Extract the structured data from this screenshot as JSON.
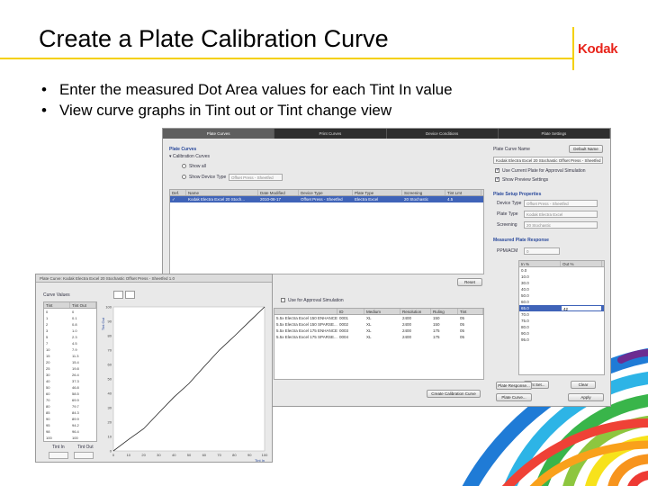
{
  "slide": {
    "title": "Create a Plate Calibration Curve",
    "logo": "Kodak",
    "bullets": [
      "Enter the measured Dot Area values for each Tint In value",
      "View curve graphs in Tint out or Tint change view"
    ],
    "bullet_glyph": "•",
    "colors": {
      "accent_rule": "#f4d000",
      "logo": "#e8241b"
    }
  },
  "screenshot": {
    "tabs": [
      "Plate Curves",
      "Print Curves",
      "Device Conditions",
      "Plate Settings"
    ],
    "left": {
      "header": "Plate Curves",
      "section": "Calibration Curves",
      "show_all": "Show all",
      "show_device_type": "Show Device Type",
      "device_type_value": "Offset Press - Sheetfed",
      "columns": [
        "Def.",
        "Name",
        "Date Modified",
        "Device Type",
        "Plate Type",
        "Screening",
        "Tint Lmt"
      ],
      "rows": [
        {
          "def": "✓",
          "name": "Kodak Electra Excel 20 Stoch...",
          "date": "2010-08-17",
          "device": "Offset Press - Sheetfed",
          "plate": "Electra Excel",
          "screen": "20 Stochastic",
          "tint": "4.5"
        }
      ],
      "reset": "Reset",
      "use_for_approval": "Use for Approval Simulation",
      "lower_columns": [
        "ID",
        "Medium",
        "Resolution",
        "Ruling",
        "Tint"
      ],
      "lower_rows": [
        [
          "5.5x Electra Excel 150 ENHANCE...",
          "0001",
          "XL",
          "2400",
          "150",
          "05"
        ],
        [
          "5.5x Electra Excel 150 SPARSE...",
          "0002",
          "XL",
          "2400",
          "150",
          "05"
        ],
        [
          "5.5x Electra Excel 175 ENHANCE...",
          "0003",
          "XL",
          "2400",
          "175",
          "05"
        ],
        [
          "5.5x Electra Excel 175 SPARSE...",
          "0004",
          "XL",
          "2400",
          "175",
          "05"
        ]
      ],
      "create_button": "Create Calibration Curve"
    },
    "right": {
      "plate_curve_name_label": "Plate Curve Name",
      "default_name_button": "Default Name",
      "name_value": "Kodak Electra Excel 20 Stochastic Offset Press - Sheetfed",
      "check1": "Use Current Plate for Approval Simulation",
      "check2": "Show Preview Settings",
      "plate_setup_header": "Plate Setup Properties",
      "device_type_label": "Device Type",
      "device_type_value": "Offset Press - Sheetfed",
      "plate_type_label": "Plate Type",
      "plate_type_value": "Kodak Electra Excel",
      "screening_label": "Screening",
      "screening_value": "20 Stochastic",
      "measured_header": "Measured Plate Response",
      "ppm_label": "PPM/ACM",
      "ppm_value": "0",
      "list_cols": [
        "In %",
        "Out %"
      ],
      "list_rows": [
        [
          "0.0",
          ""
        ],
        [
          "10.0",
          ""
        ],
        [
          "30.0",
          ""
        ],
        [
          "40.0",
          ""
        ],
        [
          "50.0",
          ""
        ],
        [
          "60.0",
          ""
        ],
        [
          "65.0",
          ""
        ],
        [
          "70.0",
          ""
        ],
        [
          "75.0",
          ""
        ],
        [
          "80.0",
          ""
        ],
        [
          "90.0",
          ""
        ],
        [
          "95.0",
          ""
        ]
      ],
      "selected_index": 6,
      "selected_out": "42",
      "tint_set": "Tint Set...",
      "clear": "Clear",
      "plate_response": "Plate Response...",
      "plate_curve": "Plate Curve...",
      "apply": "Apply"
    },
    "front": {
      "title": "Plate Curve: Kodak Electra Excel 20 Stochastic Offset Press - Sheetfed 1.0",
      "section": "Curve Values",
      "cols": [
        "Tint",
        "Tint Out"
      ],
      "rows": [
        [
          "0",
          "0"
        ],
        [
          "1",
          "0.1"
        ],
        [
          "2",
          "0.8"
        ],
        [
          "3",
          "1.0"
        ],
        [
          "5",
          "2.3"
        ],
        [
          "7",
          "4.5"
        ],
        [
          "10",
          "7.9"
        ],
        [
          "15",
          "11.3"
        ],
        [
          "20",
          "15.4"
        ],
        [
          "25",
          "19.8"
        ],
        [
          "30",
          "26.4"
        ],
        [
          "40",
          "37.3"
        ],
        [
          "50",
          "46.8"
        ],
        [
          "60",
          "58.5"
        ],
        [
          "70",
          "69.9"
        ],
        [
          "80",
          "79.7"
        ],
        [
          "85",
          "84.3"
        ],
        [
          "90",
          "89.9"
        ],
        [
          "95",
          "94.2"
        ],
        [
          "98",
          "96.4"
        ],
        [
          "100",
          "100"
        ]
      ],
      "bottom_labels": [
        "Tint In",
        "Tint Out"
      ],
      "y_axis_label": "Tint Out",
      "x_axis_label": "Tint In",
      "tick_labels": [
        "0",
        "10",
        "20",
        "30",
        "40",
        "50",
        "60",
        "70",
        "80",
        "90",
        "100"
      ]
    }
  },
  "chart_data": {
    "type": "line",
    "x": [
      0,
      10,
      20,
      30,
      40,
      50,
      60,
      70,
      80,
      90,
      100
    ],
    "series": [
      {
        "values": [
          0,
          7.9,
          15.4,
          26.4,
          37.3,
          46.8,
          58.5,
          69.9,
          79.7,
          89.9,
          100
        ]
      }
    ],
    "xlabel": "Tint In",
    "ylabel": "Tint Out",
    "xlim": [
      0,
      100
    ],
    "ylim": [
      0,
      100
    ],
    "grid": false
  }
}
